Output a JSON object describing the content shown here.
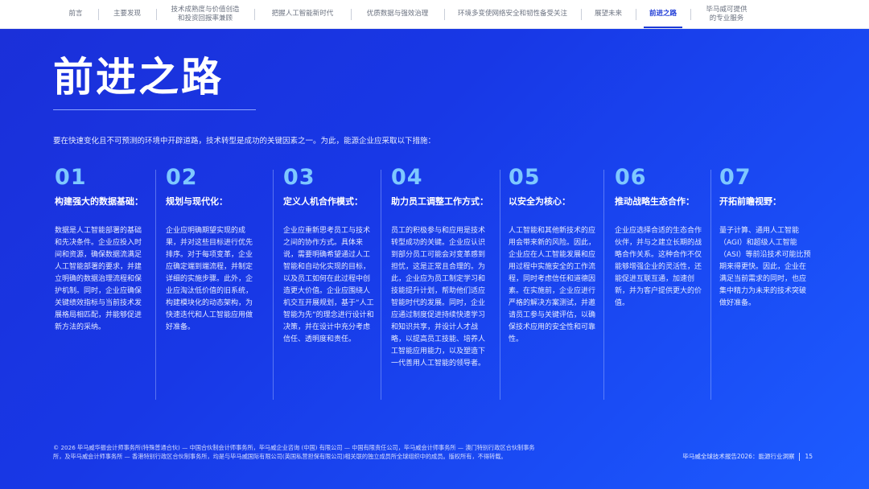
{
  "nav": {
    "items": [
      {
        "label": "前言",
        "w": 1
      },
      {
        "label": "主要发现"
      },
      {
        "label": "技术成熟度与价值创造\n和投资回报率兼顾"
      },
      {
        "label": "把握人工智能新时代"
      },
      {
        "label": "优质数据与强效治理"
      },
      {
        "label": "环境多变使网络安全和韧性备受关注"
      },
      {
        "label": "展望未来"
      },
      {
        "label": "前进之路",
        "active": true
      },
      {
        "label": "毕马威可提供\n的专业服务"
      }
    ]
  },
  "title": "前进之路",
  "intro": "要在快速变化且不可预测的环境中开辟道路，技术转型是成功的关键因素之一。为此，能源企业应采取以下措施：",
  "steps": [
    {
      "num": "01",
      "heading": "构建强大的数据基础：",
      "body": "数据是人工智能部署的基础和先决条件。企业应投入时间和资源，确保数据流满足人工智能部署的要求，并建立明确的数据治理流程和保护机制。同时，企业应确保关键绩效指标与当前技术发展格局相匹配，并能够促进新方法的采纳。"
    },
    {
      "num": "02",
      "heading": "规划与现代化：",
      "body": "企业应明确期望实现的成果，并对这些目标进行优先排序。对于每项变革，企业应确定端到端流程，并制定详细的实施步骤。此外，企业应淘汰低价值的旧系统，构建模块化的动态架构，为快速迭代和人工智能应用做好准备。"
    },
    {
      "num": "03",
      "heading": "定义人机合作模式：",
      "body": "企业应重新思考员工与技术之间的协作方式。具体来说，需要明确希望通过人工智能和自动化实现的目标，以及员工如何在此过程中创造更大价值。企业应围绕人机交互开展规划，基于“人工智能为先”的理念进行设计和决策，并在设计中充分考虑信任、透明度和责任。"
    },
    {
      "num": "04",
      "heading": "助力员工调整工作方式：",
      "body": "员工的积极参与和应用是技术转型成功的关键。企业应认识到部分员工可能会对变革感到担忧，这是正常且合理的。为此，企业应为员工制定学习和技能提升计划，帮助他们适应智能时代的发展。同时，企业应通过制度促进持续快速学习和知识共享，并设计人才战略，以提高员工技能、培养人工智能应用能力，以及塑造下一代善用人工智能的领导者。"
    },
    {
      "num": "05",
      "heading": "以安全为核心：",
      "body": "人工智能和其他新技术的应用会带来新的风险。因此，企业应在人工智能发展和应用过程中实施安全的工作流程，同时考虑信任和道德因素。在实施前，企业应进行严格的解决方案测试，并邀请员工参与关键评估，以确保技术应用的安全性和可靠性。"
    },
    {
      "num": "06",
      "heading": "推动战略生态合作：",
      "body": "企业应选择合适的生态合作伙伴，并与之建立长期的战略合作关系。这种合作不仅能够增强企业的灵活性，还能促进互联互通，加速创新，并为客户提供更大的价值。"
    },
    {
      "num": "07",
      "heading": "开拓前瞻视野：",
      "body": "量子计算、通用人工智能（AGI）和超级人工智能（ASI）等前沿技术可能比预期来得更快。因此，企业在满足当前需求的同时，也应集中精力为未来的技术突破做好准备。"
    }
  ],
  "footer": {
    "copyright": "© 2026 毕马威华振会计师事务所(特殊普通合伙) — 中国合伙制会计师事务所，毕马威企业咨询 (中国) 有限公司 — 中国有限责任公司，毕马威会计师事务所 — 澳门特别行政区合伙制事务所，及毕马威会计师事务所 — 香港特别行政区合伙制事务所，均是与毕马威国际有限公司(英国私营担保有限公司)相关联的独立成员所全球组织中的成员。版权所有，不得转载。",
    "report": "毕马威全球技术报告2026：能源行业洞察",
    "page": "15"
  }
}
